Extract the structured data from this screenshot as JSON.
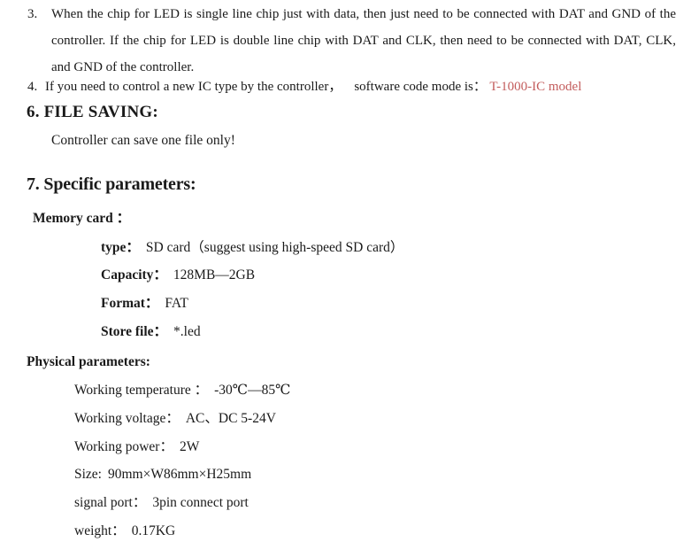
{
  "document": {
    "background_color": "#ffffff",
    "text_color": "#1a1a1a",
    "accent_red": "#c35c5c"
  },
  "list_items": [
    {
      "marker": "3.",
      "text": "When the chip for LED is single line chip just with data, then just need to be connected with DAT and GND of the controller. If the chip for LED is double line chip with DAT and CLK, then need to be connected with DAT, CLK, and GND of the controller."
    },
    {
      "marker": "4.",
      "text_before": "If you need to control a new IC type by the controller，",
      "text_middle": "software code mode is：",
      "highlight": "T-1000-IC model"
    }
  ],
  "sections": [
    {
      "heading": "6. FILE SAVING:",
      "note": "Controller can save one file only!"
    },
    {
      "heading": "7. Specific parameters:",
      "groups": [
        {
          "title": "Memory card ：",
          "rows": [
            {
              "label": "type：",
              "value": "SD card（suggest using high-speed SD card）"
            },
            {
              "label": "Capacity：",
              "value": "128MB—2GB"
            },
            {
              "label": "Format：",
              "value": "FAT"
            },
            {
              "label": "Store file：",
              "value": "*.led"
            }
          ]
        },
        {
          "title": "Physical parameters:",
          "rows": [
            {
              "label": "Working temperature ：",
              "value": "-30℃—85℃"
            },
            {
              "label": "Working voltage：",
              "value": "AC、DC 5-24V"
            },
            {
              "label": "Working power：",
              "value": "2W"
            },
            {
              "label": "Size:",
              "value": "90mm×W86mm×H25mm"
            },
            {
              "label": "signal port：",
              "value": "3pin connect port"
            },
            {
              "label": "weight：",
              "value": "0.17KG"
            }
          ]
        }
      ]
    }
  ]
}
